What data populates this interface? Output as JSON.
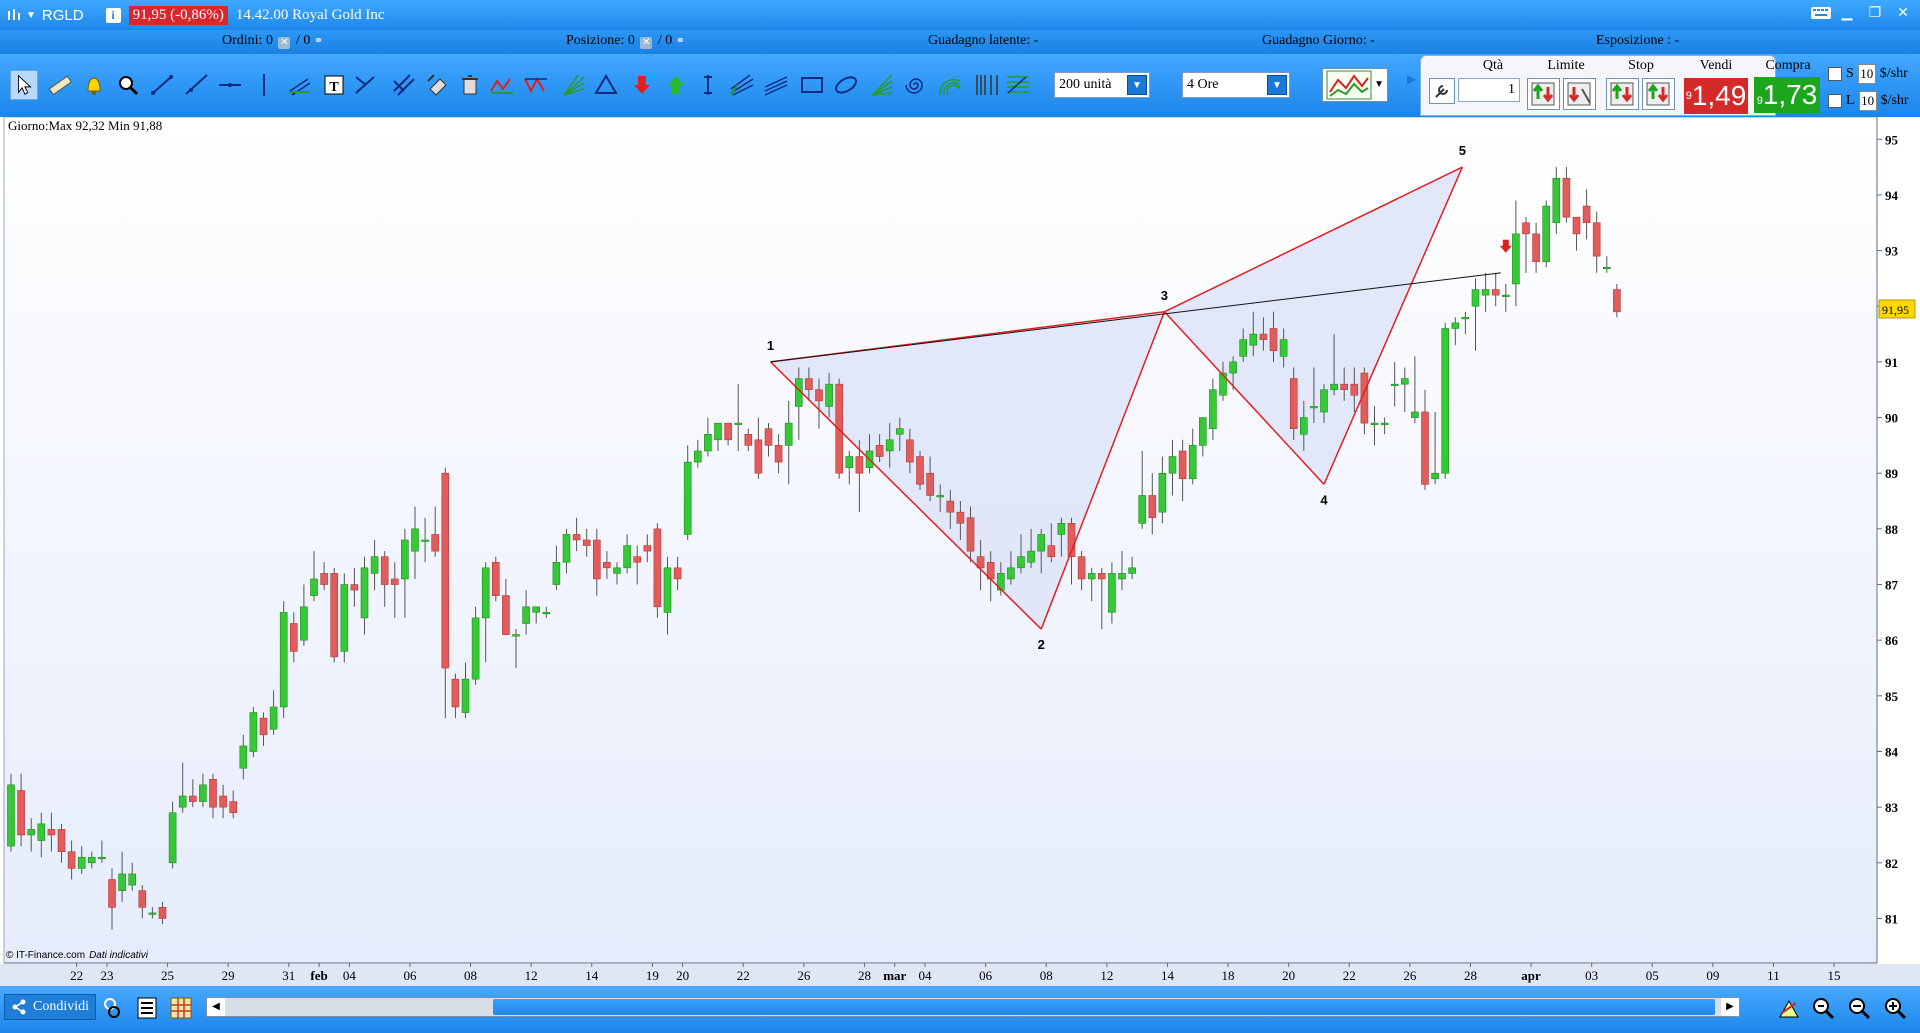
{
  "titlebar": {
    "symbol": "RGLD",
    "info_glyph": "i",
    "price_change": "91,95 (-0,86%)",
    "description": "14.42.00 Royal Gold Inc"
  },
  "status": {
    "orders_label": "Ordini:",
    "orders_value": "0",
    "orders_value2": "0",
    "position_label": "Posizione:",
    "position_value": "0",
    "position_value2": "0",
    "unrealized_label": "Guadagno latente:",
    "unrealized_value": "-",
    "day_gain_label": "Guadagno Giorno:",
    "day_gain_value": "-",
    "exposure_label": "Esposizione :",
    "exposure_value": "-"
  },
  "toolbar": {
    "bars_combo": "200 unità",
    "timeframe_combo": "4 Ore",
    "tools": [
      "pointer-icon",
      "ruler-icon",
      "alarm-bell-icon",
      "zoom-icon",
      "trendline-icon",
      "ray-icon",
      "horizontal-line-icon",
      "vertical-line-icon",
      "channel-icon",
      "text-icon",
      "cross-lines-icon",
      "cross-hatch-icon",
      "eraser-icon",
      "trash-icon",
      "zigzag-icon",
      "pattern-icon",
      "gann-fan-icon",
      "triangle-icon",
      "sell-arrow-icon",
      "buy-arrow-icon",
      "vertical-range-icon",
      "pitchfork-icon",
      "regression-icon",
      "rectangle-icon",
      "ellipse-icon",
      "fibonacci-fan-icon",
      "spiral-icon",
      "arc-icon",
      "fibonacci-time-icon",
      "fibonacci-retracement-icon"
    ]
  },
  "trade": {
    "qty_label": "Qtà",
    "qty_value": "1",
    "limit_label": "Limite",
    "stop_label": "Stop",
    "sell_label": "Vendi",
    "buy_label": "Compra",
    "sell_prefix": "9",
    "sell_price": "1,49",
    "buy_prefix": "9",
    "buy_price": "1,73",
    "s_label": "S",
    "l_label": "L",
    "s_value": "10",
    "l_value": "10",
    "unit": "$/shr"
  },
  "chart": {
    "day_info": "Giorno:Max 92,32 Min 91,88",
    "copyright": "© IT-Finance.com",
    "copyright_note": "Dati indicativi",
    "current_price_label": "91,95",
    "colors": {
      "up": "#37c837",
      "down": "#e25c5c",
      "pattern": "#e02020",
      "fill": "#dfe6f8"
    }
  },
  "chart_data": {
    "type": "candlestick",
    "ylim": [
      80.2,
      95.4
    ],
    "yticks": [
      "81",
      "82",
      "83",
      "84",
      "85",
      "86",
      "87",
      "88",
      "89",
      "90",
      "91",
      "92",
      "93",
      "94",
      "95"
    ],
    "xticks": [
      {
        "label": "22",
        "i": 6.5
      },
      {
        "label": "23",
        "i": 9.5
      },
      {
        "label": "25",
        "i": 15.5
      },
      {
        "label": "29",
        "i": 21.5
      },
      {
        "label": "31",
        "i": 27.5
      },
      {
        "label": "feb",
        "i": 30.5,
        "bold": true
      },
      {
        "label": "04",
        "i": 33.5
      },
      {
        "label": "06",
        "i": 39.5
      },
      {
        "label": "08",
        "i": 45.5
      },
      {
        "label": "12",
        "i": 51.5
      },
      {
        "label": "14",
        "i": 57.5
      },
      {
        "label": "19",
        "i": 63.5
      },
      {
        "label": "20",
        "i": 66.5
      },
      {
        "label": "22",
        "i": 72.5
      },
      {
        "label": "26",
        "i": 78.5
      },
      {
        "label": "28",
        "i": 84.5
      },
      {
        "label": "mar",
        "i": 87.5,
        "bold": true
      },
      {
        "label": "04",
        "i": 90.5
      },
      {
        "label": "06",
        "i": 96.5
      },
      {
        "label": "08",
        "i": 102.5
      },
      {
        "label": "12",
        "i": 108.5
      },
      {
        "label": "14",
        "i": 114.5
      },
      {
        "label": "18",
        "i": 120.5
      },
      {
        "label": "20",
        "i": 126.5
      },
      {
        "label": "22",
        "i": 132.5
      },
      {
        "label": "26",
        "i": 138.5
      },
      {
        "label": "28",
        "i": 144.5
      },
      {
        "label": "apr",
        "i": 150.5,
        "bold": true
      },
      {
        "label": "03",
        "i": 156.5
      },
      {
        "label": "05",
        "i": 162.5
      },
      {
        "label": "09",
        "i": 168.5
      },
      {
        "label": "11",
        "i": 174.5
      },
      {
        "label": "15",
        "i": 180.5
      }
    ],
    "candles": [
      [
        82.3,
        83.4,
        83.6,
        82.2
      ],
      [
        83.3,
        82.5,
        83.6,
        82.3
      ],
      [
        82.5,
        82.6,
        82.8,
        82.2
      ],
      [
        82.4,
        82.7,
        82.9,
        82.1
      ],
      [
        82.6,
        82.5,
        82.9,
        82.2
      ],
      [
        82.6,
        82.2,
        82.7,
        82.0
      ],
      [
        82.2,
        81.9,
        82.4,
        81.7
      ],
      [
        81.9,
        82.1,
        82.3,
        81.8
      ],
      [
        82.0,
        82.1,
        82.2,
        81.9
      ],
      [
        82.1,
        82.1,
        82.4,
        82.0
      ],
      [
        81.7,
        81.2,
        81.9,
        80.8
      ],
      [
        81.5,
        81.8,
        82.2,
        81.3
      ],
      [
        81.6,
        81.8,
        82.0,
        81.5
      ],
      [
        81.5,
        81.2,
        81.6,
        81.0
      ],
      [
        81.1,
        81.1,
        81.2,
        81.0
      ],
      [
        81.2,
        81.0,
        81.3,
        80.9
      ],
      [
        82.0,
        82.9,
        83.1,
        81.9
      ],
      [
        83.0,
        83.2,
        83.8,
        82.9
      ],
      [
        83.2,
        83.1,
        83.5,
        83.0
      ],
      [
        83.1,
        83.4,
        83.6,
        83.0
      ],
      [
        83.5,
        83.0,
        83.6,
        82.8
      ],
      [
        83.2,
        83.0,
        83.4,
        82.8
      ],
      [
        83.1,
        82.9,
        83.3,
        82.8
      ],
      [
        83.7,
        84.1,
        84.3,
        83.5
      ],
      [
        84.0,
        84.7,
        84.8,
        83.9
      ],
      [
        84.6,
        84.3,
        84.7,
        84.1
      ],
      [
        84.4,
        84.8,
        85.1,
        84.3
      ],
      [
        84.8,
        86.5,
        86.7,
        84.6
      ],
      [
        86.3,
        85.8,
        86.5,
        85.6
      ],
      [
        86.0,
        86.6,
        87.0,
        85.9
      ],
      [
        86.8,
        87.1,
        87.6,
        86.7
      ],
      [
        87.2,
        87.0,
        87.4,
        86.9
      ],
      [
        87.2,
        85.7,
        87.3,
        85.6
      ],
      [
        85.8,
        87.0,
        87.2,
        85.6
      ],
      [
        87.0,
        86.9,
        87.3,
        86.6
      ],
      [
        86.4,
        87.3,
        87.5,
        86.1
      ],
      [
        87.2,
        87.5,
        87.8,
        86.9
      ],
      [
        87.5,
        87.0,
        87.6,
        86.6
      ],
      [
        87.1,
        87.0,
        87.4,
        86.4
      ],
      [
        87.1,
        87.8,
        88.0,
        86.4
      ],
      [
        87.6,
        88.0,
        88.4,
        87.1
      ],
      [
        87.8,
        87.8,
        88.2,
        87.4
      ],
      [
        87.9,
        87.6,
        88.4,
        87.5
      ],
      [
        89.0,
        85.5,
        89.1,
        84.6
      ],
      [
        85.3,
        84.8,
        85.4,
        84.6
      ],
      [
        84.7,
        85.3,
        85.6,
        84.6
      ],
      [
        85.3,
        86.4,
        86.6,
        85.2
      ],
      [
        86.4,
        87.3,
        87.4,
        85.6
      ],
      [
        87.4,
        86.8,
        87.5,
        86.7
      ],
      [
        86.8,
        86.1,
        87.1,
        86.1
      ],
      [
        86.1,
        86.1,
        86.2,
        85.5
      ],
      [
        86.3,
        86.6,
        86.9,
        86.1
      ],
      [
        86.5,
        86.6,
        86.6,
        86.3
      ],
      [
        86.5,
        86.5,
        86.6,
        86.4
      ],
      [
        87.0,
        87.4,
        87.7,
        86.9
      ],
      [
        87.4,
        87.9,
        88.0,
        87.2
      ],
      [
        87.9,
        87.8,
        88.2,
        87.6
      ],
      [
        87.8,
        87.7,
        88.0,
        87.5
      ],
      [
        87.8,
        87.1,
        88.0,
        86.8
      ],
      [
        87.4,
        87.3,
        87.6,
        87.1
      ],
      [
        87.2,
        87.3,
        87.4,
        87.0
      ],
      [
        87.3,
        87.7,
        87.9,
        87.2
      ],
      [
        87.5,
        87.4,
        87.7,
        87.0
      ],
      [
        87.7,
        87.6,
        87.9,
        87.4
      ],
      [
        88.0,
        86.6,
        88.1,
        86.4
      ],
      [
        86.5,
        87.3,
        87.5,
        86.1
      ],
      [
        87.3,
        87.1,
        87.5,
        86.9
      ],
      [
        87.9,
        89.2,
        89.5,
        87.8
      ],
      [
        89.2,
        89.4,
        89.6,
        89.1
      ],
      [
        89.4,
        89.7,
        90.0,
        89.3
      ],
      [
        89.6,
        89.9,
        89.9,
        89.4
      ],
      [
        89.9,
        89.6,
        89.9,
        89.5
      ],
      [
        89.9,
        89.9,
        90.6,
        89.4
      ],
      [
        89.7,
        89.5,
        89.8,
        89.4
      ],
      [
        89.6,
        89.0,
        90.0,
        88.9
      ],
      [
        89.8,
        89.5,
        89.9,
        89.3
      ],
      [
        89.5,
        89.2,
        89.7,
        89.0
      ],
      [
        89.5,
        89.9,
        90.3,
        88.8
      ],
      [
        90.2,
        90.7,
        90.9,
        89.6
      ],
      [
        90.7,
        90.5,
        90.9,
        90.3
      ],
      [
        90.5,
        90.3,
        90.7,
        89.8
      ],
      [
        90.2,
        90.6,
        90.8,
        90.0
      ],
      [
        90.6,
        89.0,
        90.7,
        88.9
      ],
      [
        89.1,
        89.3,
        89.4,
        88.8
      ],
      [
        89.3,
        89.0,
        89.6,
        88.3
      ],
      [
        89.1,
        89.4,
        89.7,
        89.0
      ],
      [
        89.5,
        89.3,
        89.7,
        89.2
      ],
      [
        89.4,
        89.6,
        89.9,
        89.1
      ],
      [
        89.7,
        89.8,
        90.0,
        89.4
      ],
      [
        89.6,
        89.2,
        89.8,
        89.0
      ],
      [
        89.3,
        88.8,
        89.4,
        88.7
      ],
      [
        89.0,
        88.6,
        89.3,
        88.5
      ],
      [
        88.6,
        88.6,
        88.8,
        88.3
      ],
      [
        88.5,
        88.3,
        88.7,
        88.0
      ],
      [
        88.3,
        88.1,
        88.5,
        87.8
      ],
      [
        88.2,
        87.6,
        88.4,
        87.4
      ],
      [
        87.5,
        87.3,
        87.8,
        86.9
      ],
      [
        87.4,
        87.1,
        87.6,
        86.7
      ],
      [
        86.9,
        87.2,
        87.4,
        86.8
      ],
      [
        87.1,
        87.3,
        87.6,
        87.0
      ],
      [
        87.3,
        87.5,
        87.9,
        87.2
      ],
      [
        87.4,
        87.6,
        88.0,
        87.3
      ],
      [
        87.6,
        87.9,
        88.0,
        87.2
      ],
      [
        87.7,
        87.5,
        88.1,
        87.4
      ],
      [
        87.9,
        88.1,
        88.2,
        87.5
      ],
      [
        88.1,
        87.5,
        88.2,
        87.0
      ],
      [
        87.5,
        87.1,
        87.6,
        86.9
      ],
      [
        87.1,
        87.2,
        87.3,
        86.7
      ],
      [
        87.2,
        87.1,
        87.3,
        86.2
      ],
      [
        86.5,
        87.2,
        87.4,
        86.3
      ],
      [
        87.1,
        87.2,
        87.6,
        86.9
      ],
      [
        87.2,
        87.3,
        87.5,
        87.1
      ],
      [
        88.1,
        88.6,
        89.4,
        88.0
      ],
      [
        88.6,
        88.2,
        89.0,
        87.9
      ],
      [
        88.3,
        89.0,
        89.3,
        88.1
      ],
      [
        89.0,
        89.3,
        89.6,
        88.6
      ],
      [
        89.4,
        88.9,
        89.6,
        88.5
      ],
      [
        88.9,
        89.5,
        89.8,
        88.8
      ],
      [
        89.5,
        90.0,
        90.0,
        89.3
      ],
      [
        89.8,
        90.5,
        90.7,
        89.6
      ],
      [
        90.4,
        90.8,
        91.0,
        90.3
      ],
      [
        90.8,
        91.0,
        91.1,
        90.5
      ],
      [
        91.1,
        91.4,
        91.6,
        91.0
      ],
      [
        91.3,
        91.5,
        91.9,
        91.1
      ],
      [
        91.5,
        91.4,
        91.8,
        91.2
      ],
      [
        91.6,
        91.2,
        91.9,
        91.0
      ],
      [
        91.1,
        91.4,
        91.6,
        90.9
      ],
      [
        90.7,
        89.8,
        90.9,
        89.6
      ],
      [
        89.7,
        90.0,
        90.3,
        89.4
      ],
      [
        90.2,
        90.2,
        90.9,
        89.9
      ],
      [
        90.1,
        90.5,
        90.6,
        89.9
      ],
      [
        90.5,
        90.6,
        91.5,
        90.4
      ],
      [
        90.6,
        90.5,
        90.9,
        90.3
      ],
      [
        90.6,
        90.4,
        90.9,
        90.1
      ],
      [
        90.8,
        89.9,
        90.9,
        89.7
      ],
      [
        89.9,
        89.9,
        90.2,
        89.5
      ],
      [
        89.9,
        89.9,
        90.0,
        89.7
      ],
      [
        90.6,
        90.6,
        91.0,
        90.2
      ],
      [
        90.6,
        90.7,
        90.9,
        90.1
      ],
      [
        90.0,
        90.1,
        91.1,
        89.9
      ],
      [
        90.1,
        88.8,
        90.5,
        88.7
      ],
      [
        88.9,
        89.0,
        90.1,
        88.8
      ],
      [
        89.0,
        91.6,
        91.7,
        88.9
      ],
      [
        91.6,
        91.7,
        91.8,
        91.3
      ],
      [
        91.8,
        91.8,
        91.9,
        91.5
      ],
      [
        92.0,
        92.3,
        92.5,
        91.2
      ],
      [
        92.2,
        92.3,
        92.6,
        91.9
      ],
      [
        92.3,
        92.2,
        92.6,
        92.0
      ],
      [
        92.2,
        92.2,
        92.4,
        91.9
      ],
      [
        92.4,
        93.3,
        93.9,
        92.0
      ],
      [
        93.5,
        93.3,
        93.6,
        92.6
      ],
      [
        93.3,
        92.8,
        93.5,
        92.6
      ],
      [
        92.8,
        93.8,
        93.9,
        92.7
      ],
      [
        93.5,
        94.3,
        94.5,
        93.3
      ],
      [
        94.3,
        93.6,
        94.5,
        93.5
      ],
      [
        93.6,
        93.3,
        93.6,
        93.0
      ],
      [
        93.8,
        93.5,
        94.1,
        93.2
      ],
      [
        93.5,
        92.9,
        93.7,
        92.6
      ],
      [
        92.7,
        92.7,
        92.9,
        92.6
      ],
      [
        92.3,
        91.9,
        92.4,
        91.8
      ]
    ],
    "pattern_points": [
      {
        "label": "1",
        "i": 75.2,
        "price": 91.0
      },
      {
        "label": "2",
        "i": 102.0,
        "price": 86.2
      },
      {
        "label": "3",
        "i": 114.2,
        "price": 91.9
      },
      {
        "label": "4",
        "i": 130.0,
        "price": 88.8
      },
      {
        "label": "5",
        "i": 143.7,
        "price": 94.5
      }
    ],
    "trendline": {
      "from": {
        "i": 75.2,
        "price": 91.0
      },
      "to": {
        "i": 147.5,
        "price": 92.6
      }
    },
    "signal_arrow": {
      "i": 148.0,
      "price": 93.05
    },
    "current_price": 91.95
  },
  "bottom": {
    "share_label": "Condividi"
  }
}
